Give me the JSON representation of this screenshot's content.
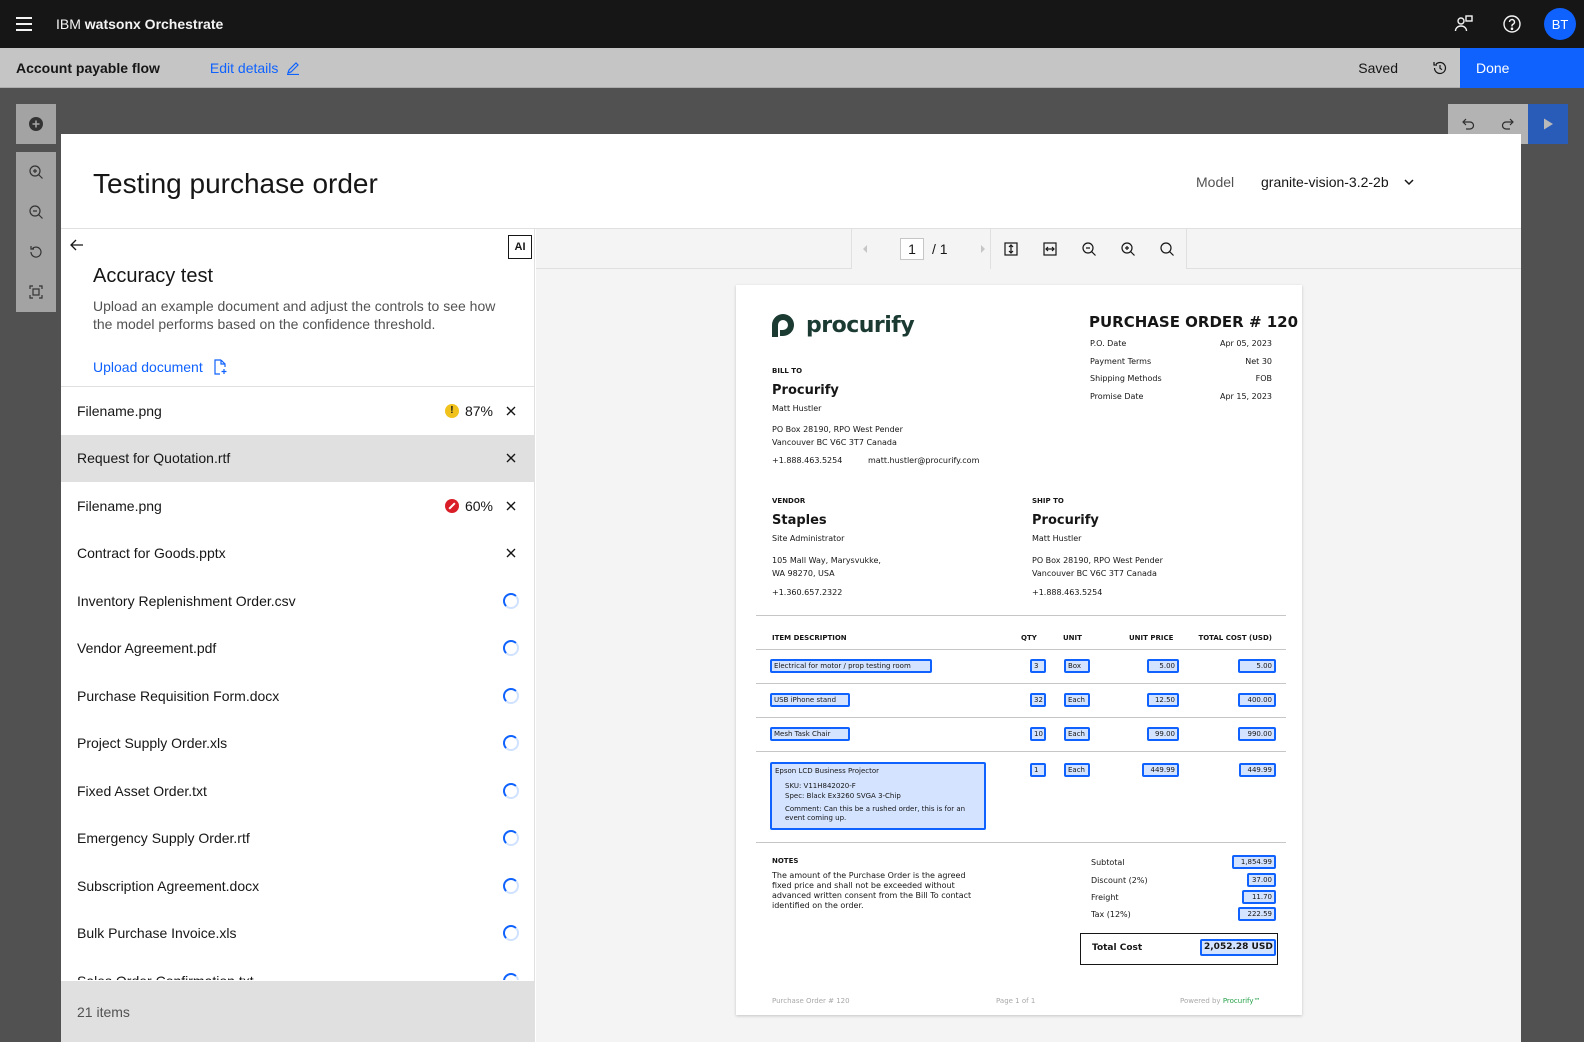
{
  "app": {
    "brand_prefix": "IBM",
    "brand_name": "watsonx Orchestrate",
    "avatar_initials": "BT"
  },
  "subbar": {
    "flow_title": "Account payable flow",
    "edit_details": "Edit details",
    "saved": "Saved",
    "done": "Done"
  },
  "modal": {
    "title": "Testing purchase order",
    "model_label": "Model",
    "model_value": "granite-vision-3.2-2b"
  },
  "panel": {
    "ai_badge": "AI",
    "title": "Accuracy test",
    "description": "Upload an example document and adjust the controls to see how the model performs based on the confidence threshold.",
    "upload": "Upload document",
    "footer_count": "21 items",
    "files": [
      {
        "name": "Filename.png",
        "status": "warning",
        "confidence": "87%",
        "state": "done"
      },
      {
        "name": "Request for Quotation.rtf",
        "status": "",
        "confidence": "",
        "state": "done",
        "selected": true
      },
      {
        "name": "Filename.png",
        "status": "error",
        "confidence": "60%",
        "state": "done"
      },
      {
        "name": "Contract for Goods.pptx",
        "status": "",
        "confidence": "",
        "state": "done"
      },
      {
        "name": "Inventory Replenishment Order.csv",
        "state": "loading"
      },
      {
        "name": "Vendor Agreement.pdf",
        "state": "loading"
      },
      {
        "name": "Purchase Requisition Form.docx",
        "state": "loading"
      },
      {
        "name": "Project Supply Order.xls",
        "state": "loading"
      },
      {
        "name": "Fixed Asset Order.txt",
        "state": "loading"
      },
      {
        "name": "Emergency Supply Order.rtf",
        "state": "loading"
      },
      {
        "name": "Subscription Agreement.docx",
        "state": "loading"
      },
      {
        "name": "Bulk Purchase Invoice.xls",
        "state": "loading"
      },
      {
        "name": "Sales Order Confirmation.txt",
        "state": "loading"
      }
    ]
  },
  "viewer": {
    "page_current": "1",
    "page_total": "/ 1"
  },
  "document": {
    "logo": "procurify",
    "po_title": "PURCHASE ORDER # 120",
    "meta": [
      {
        "k": "P.O. Date",
        "v": "Apr 05, 2023"
      },
      {
        "k": "Payment Terms",
        "v": "Net 30"
      },
      {
        "k": "Shipping Methods",
        "v": "FOB"
      },
      {
        "k": "Promise Date",
        "v": "Apr 15, 2023"
      }
    ],
    "bill_to": {
      "label": "BILL TO",
      "company": "Procurify",
      "contact": "Matt Hustler",
      "addr1": "PO Box 28190, RPO West Pender",
      "addr2": "Vancouver BC V6C 3T7 Canada",
      "phone": "+1.888.463.5254",
      "email": "matt.hustler@procurify.com"
    },
    "vendor": {
      "label": "VENDOR",
      "company": "Staples",
      "contact": "Site Administrator",
      "addr1": "105 Mall Way, Marysvukke,",
      "addr2": "WA 98270, USA",
      "phone": "+1.360.657.2322"
    },
    "ship_to": {
      "label": "SHIP TO",
      "company": "Procurify",
      "contact": "Matt Hustler",
      "addr1": "PO Box 28190, RPO West Pender",
      "addr2": "Vancouver BC V6C 3T7 Canada",
      "phone": "+1.888.463.5254"
    },
    "columns": {
      "desc": "ITEM DESCRIPTION",
      "qty": "QTY",
      "unit": "UNIT",
      "price": "UNIT PRICE",
      "total": "TOTAL COST (USD)"
    },
    "items": [
      {
        "desc": "Electrical for motor / prop testing room",
        "qty": "3",
        "unit": "Box",
        "price": "5.00",
        "total": "5.00"
      },
      {
        "desc": "USB iPhone stand",
        "qty": "32",
        "unit": "Each",
        "price": "12.50",
        "total": "400.00"
      },
      {
        "desc": "Mesh Task Chair",
        "qty": "10",
        "unit": "Each",
        "price": "99.00",
        "total": "990.00"
      },
      {
        "desc": "Epson LCD Business Projector",
        "qty": "1",
        "unit": "Each",
        "price": "449.99",
        "total": "449.99"
      }
    ],
    "item4_sku": "SKU: V11H842020-F",
    "item4_spec": "Spec: Black Ex3260 SVGA 3-Chip",
    "item4_comment": "Comment: Can this be a rushed order, this is for an event coming up.",
    "notes_label": "NOTES",
    "notes": "The amount of the Purchase Order is the agreed fixed price and shall not be exceeded without advanced written consent from the Bill To contact identified on the order.",
    "totals": [
      {
        "k": "Subtotal",
        "v": "1,854.99"
      },
      {
        "k": "Discount (2%)",
        "v": "37.00"
      },
      {
        "k": "Freight",
        "v": "11.70"
      },
      {
        "k": "Tax (12%)",
        "v": "222.59"
      }
    ],
    "total_label": "Total Cost",
    "total_value": "2,052.28 USD",
    "footer_left": "Purchase Order # 120",
    "footer_mid": "Page 1 of 1",
    "footer_right_prefix": "Powered by",
    "footer_right_brand": "Procurify™"
  },
  "colors": {
    "primary": "#0f62fe",
    "header_bg": "#161616",
    "warning": "#f1c21b",
    "error": "#da1e28"
  }
}
